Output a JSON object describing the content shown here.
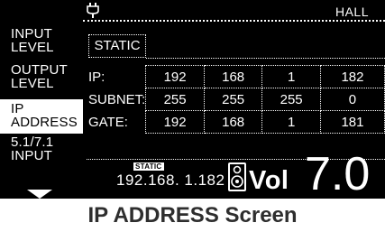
{
  "sidebar": {
    "items": [
      {
        "line1": "INPUT",
        "line2": "LEVEL"
      },
      {
        "line1": "OUTPUT",
        "line2": "LEVEL"
      },
      {
        "line1": "IP",
        "line2": "ADDRESS"
      },
      {
        "line1": "5.1/7.1",
        "line2": "INPUT"
      }
    ],
    "active": "IP ADDRESS"
  },
  "header": {
    "mode": "HALL",
    "plug_icon": "plug-icon"
  },
  "config": {
    "mode": "STATIC"
  },
  "table": {
    "rows": [
      {
        "label": "IP:",
        "values": [
          "192",
          "168",
          "1",
          "182"
        ]
      },
      {
        "label": "SUBNET:",
        "values": [
          "255",
          "255",
          "255",
          "0"
        ]
      },
      {
        "label": "GATE:",
        "values": [
          "192",
          "168",
          "1",
          "181"
        ]
      }
    ]
  },
  "status": {
    "badge": "STATIC",
    "ip": "192.168. 1.182",
    "vol_label": "Vol",
    "vol_value": "7.0",
    "speaker_icon": "speaker-icon"
  },
  "caption": "IP ADDRESS Screen"
}
